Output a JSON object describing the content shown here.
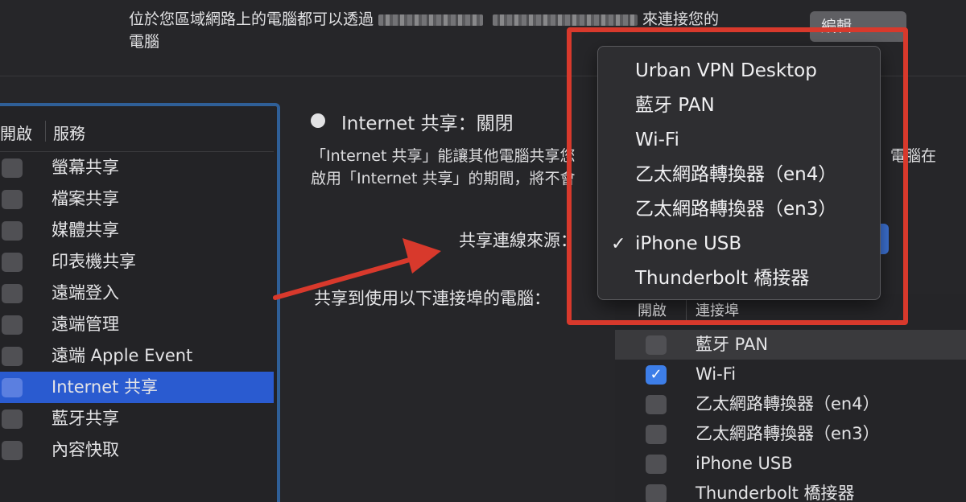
{
  "header": {
    "desc_line1_pre": "位於您區域網路上的電腦都可以透過",
    "desc_line1_post": "來連接您的",
    "desc_line2": "電腦",
    "edit_label": "編輯..."
  },
  "service_list": {
    "col_on": "開啟",
    "col_service": "服務",
    "items": [
      {
        "label": "螢幕共享"
      },
      {
        "label": "檔案共享"
      },
      {
        "label": "媒體共享"
      },
      {
        "label": "印表機共享"
      },
      {
        "label": "遠端登入"
      },
      {
        "label": "遠端管理"
      },
      {
        "label": "遠端 Apple Event"
      },
      {
        "label": "Internet 共享"
      },
      {
        "label": "藍牙共享"
      },
      {
        "label": "內容快取"
      }
    ],
    "selected_index": 7
  },
  "detail": {
    "status": "Internet 共享：關閉",
    "desc_line1": "「Internet 共享」能讓其他電腦共享您",
    "desc_line1_right": "電腦在",
    "desc_line2": "啟用「Internet 共享」的期間，將不會",
    "share_from_label": "共享連線來源：",
    "share_to_label": "共享到使用以下連接埠的電腦："
  },
  "port_table": {
    "col_on": "開啟",
    "col_port": "連接埠",
    "rows": [
      {
        "label": "藍牙 PAN",
        "checked": false
      },
      {
        "label": "Wi-Fi",
        "checked": true
      },
      {
        "label": "乙太網路轉換器（en4）",
        "checked": false
      },
      {
        "label": "乙太網路轉換器（en3）",
        "checked": false
      },
      {
        "label": "iPhone USB",
        "checked": false
      },
      {
        "label": "Thunderbolt 橋接器",
        "checked": false
      }
    ],
    "check_mark": "✓"
  },
  "source_menu": {
    "items": [
      {
        "label": "Urban VPN Desktop"
      },
      {
        "label": "藍牙 PAN"
      },
      {
        "label": "Wi-Fi"
      },
      {
        "label": "乙太網路轉換器（en4）"
      },
      {
        "label": "乙太網路轉換器（en3）"
      },
      {
        "label": "iPhone USB"
      },
      {
        "label": "Thunderbolt 橋接器"
      }
    ],
    "selected_index": 5,
    "check_mark": "✓"
  },
  "colors": {
    "annotation_red": "#d8392c",
    "selection_blue": "#2a5bd0",
    "panel_border_blue": "#2f5f97"
  }
}
